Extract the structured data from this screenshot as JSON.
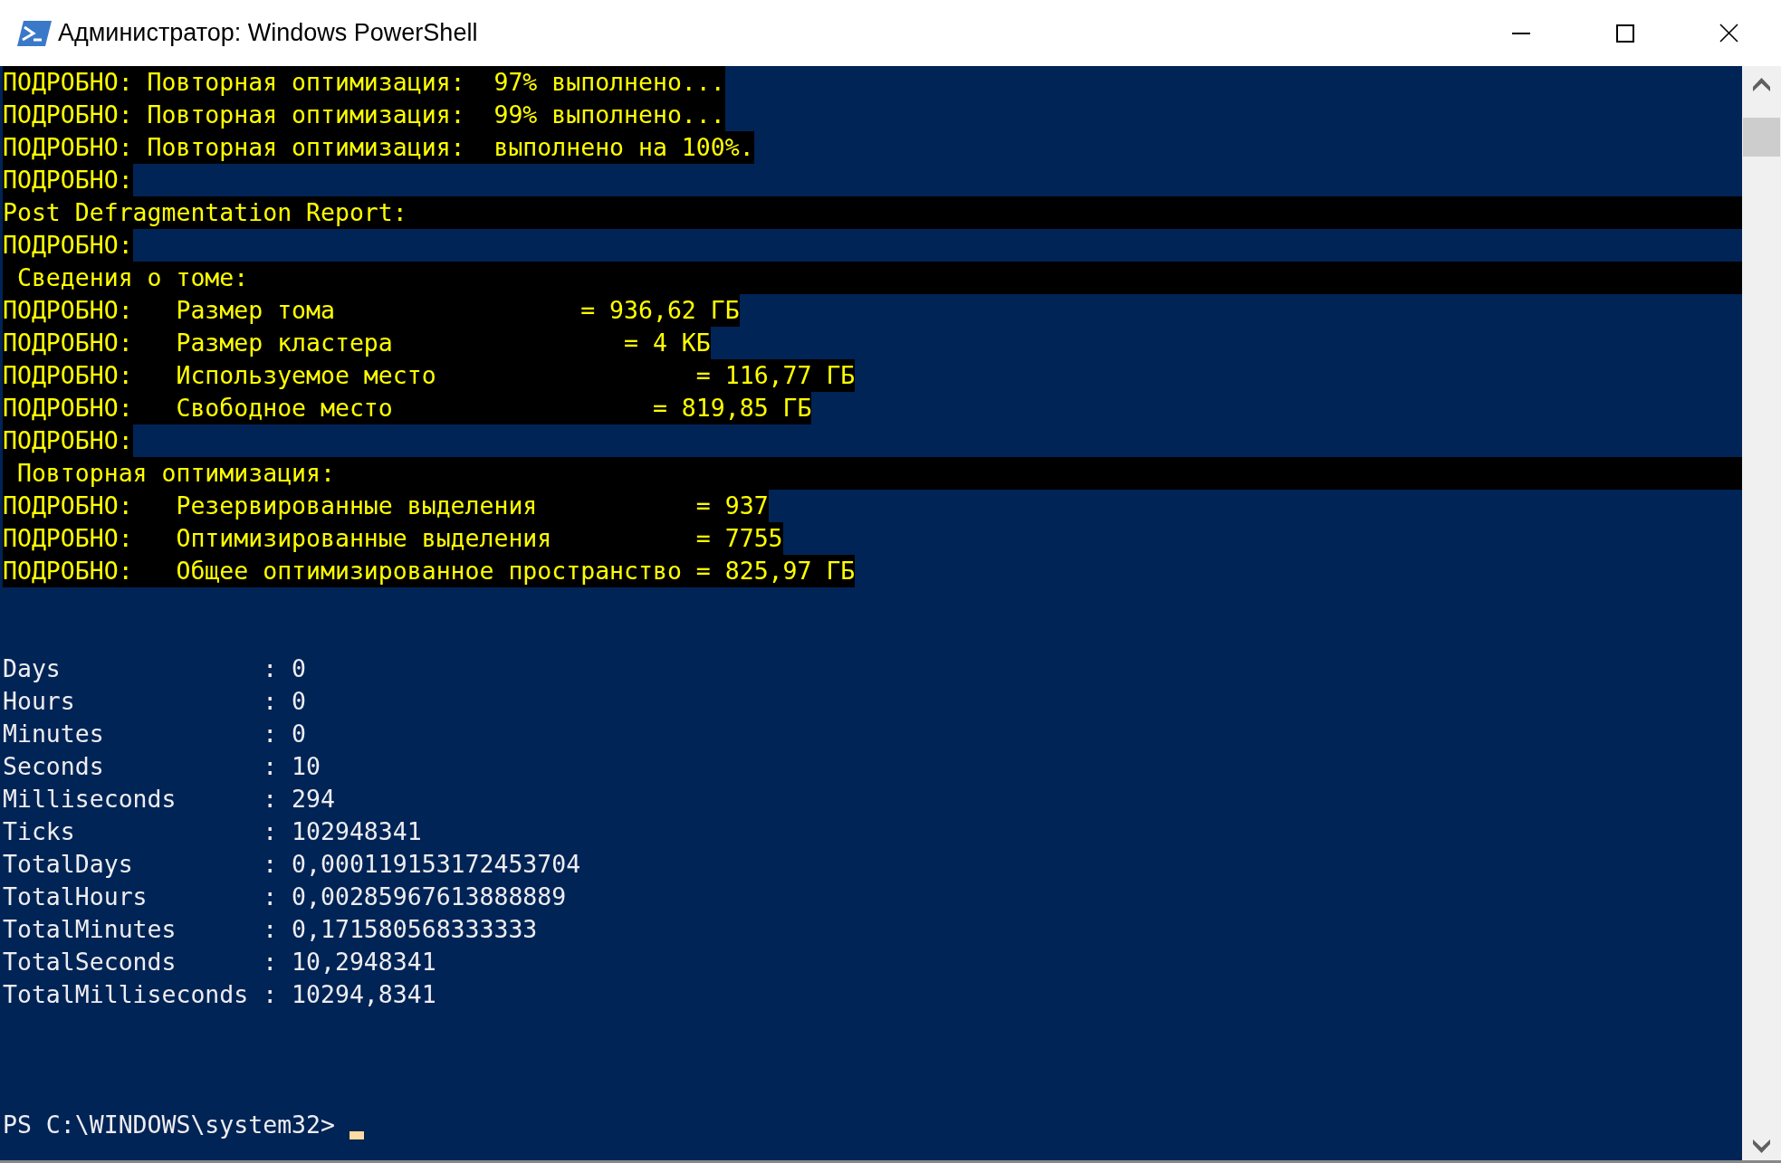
{
  "window": {
    "title": "Администратор: Windows PowerShell"
  },
  "console": {
    "lines": [
      {
        "kind": "verbose",
        "text": "ПОДРОБНО: Повторная оптимизация:  97% выполнено..."
      },
      {
        "kind": "verbose",
        "text": "ПОДРОБНО: Повторная оптимизация:  99% выполнено..."
      },
      {
        "kind": "verbose",
        "text": "ПОДРОБНО: Повторная оптимизация:  выполнено на 100%."
      },
      {
        "kind": "verbose",
        "text": "ПОДРОБНО:"
      },
      {
        "kind": "heading",
        "indent": false,
        "text": "Post Defragmentation Report:"
      },
      {
        "kind": "verbose",
        "text": "ПОДРОБНО:"
      },
      {
        "kind": "heading",
        "indent": true,
        "text": "Сведения о томе:"
      },
      {
        "kind": "verbose",
        "text": "ПОДРОБНО:   Размер тома                 = 936,62 ГБ"
      },
      {
        "kind": "verbose",
        "text": "ПОДРОБНО:   Размер кластера                = 4 КБ"
      },
      {
        "kind": "verbose",
        "text": "ПОДРОБНО:   Используемое место                  = 116,77 ГБ"
      },
      {
        "kind": "verbose",
        "text": "ПОДРОБНО:   Свободное место                  = 819,85 ГБ"
      },
      {
        "kind": "verbose",
        "text": "ПОДРОБНО:"
      },
      {
        "kind": "heading",
        "indent": true,
        "text": "Повторная оптимизация:"
      },
      {
        "kind": "verbose",
        "text": "ПОДРОБНО:   Резервированные выделения           = 937"
      },
      {
        "kind": "verbose",
        "text": "ПОДРОБНО:   Оптимизированные выделения          = 7755"
      },
      {
        "kind": "verbose",
        "text": "ПОДРОБНО:   Общее оптимизированное пространство = 825,97 ГБ"
      },
      {
        "kind": "blank"
      },
      {
        "kind": "blank"
      },
      {
        "kind": "output",
        "text": "Days              : 0"
      },
      {
        "kind": "output",
        "text": "Hours             : 0"
      },
      {
        "kind": "output",
        "text": "Minutes           : 0"
      },
      {
        "kind": "output",
        "text": "Seconds           : 10"
      },
      {
        "kind": "output",
        "text": "Milliseconds      : 294"
      },
      {
        "kind": "output",
        "text": "Ticks             : 102948341"
      },
      {
        "kind": "output",
        "text": "TotalDays         : 0,000119153172453704"
      },
      {
        "kind": "output",
        "text": "TotalHours        : 0,00285967613888889"
      },
      {
        "kind": "output",
        "text": "TotalMinutes      : 0,171580568333333"
      },
      {
        "kind": "output",
        "text": "TotalSeconds      : 10,2948341"
      },
      {
        "kind": "output",
        "text": "TotalMilliseconds : 10294,8341"
      },
      {
        "kind": "blank"
      },
      {
        "kind": "blank"
      },
      {
        "kind": "blank"
      },
      {
        "kind": "prompt",
        "text": "PS C:\\WINDOWS\\system32>"
      }
    ]
  }
}
